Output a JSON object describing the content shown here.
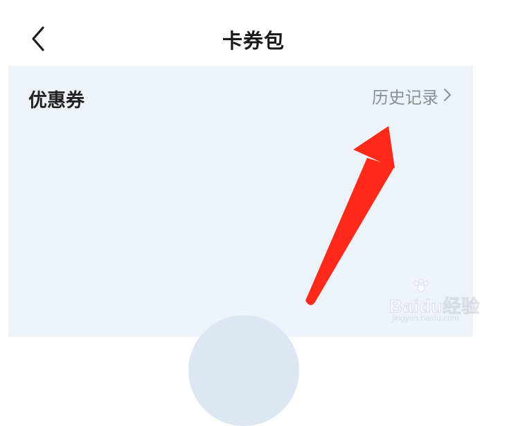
{
  "header": {
    "title": "卡券包",
    "back_icon": "back-arrow-icon"
  },
  "coupons": {
    "section_title": "优惠券",
    "history_label": "历史记录",
    "history_icon": "chevron-right-icon"
  },
  "annotation": {
    "arrow_color": "#ff2a1a"
  },
  "watermark": {
    "brand": "Baidu经验",
    "url": "jingyan.baidu.com"
  },
  "colors": {
    "panel_bg": "#eef3f9",
    "title_text": "#1a1a1a",
    "link_text": "#8a8f96"
  }
}
